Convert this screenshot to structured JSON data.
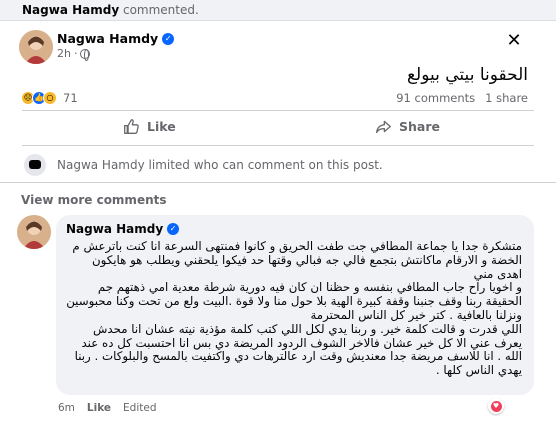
{
  "notification": {
    "actor": "Nagwa Hamdy",
    "action": "commented."
  },
  "post": {
    "author": "Nagwa Hamdy",
    "time": "2h",
    "privacy_icon": "globe-icon",
    "text": "الحقونا بيتي بيولع",
    "reaction_count": "71",
    "reaction_icons": [
      "sad-reaction-icon",
      "like-reaction-icon",
      "wow-reaction-icon"
    ],
    "comments": "91 comments",
    "shares": "1 share"
  },
  "actions": {
    "like": "Like",
    "share": "Share"
  },
  "limited_notice": "Nagwa Hamdy limited who can comment on this post.",
  "view_more": "View more comments",
  "comment": {
    "author": "Nagwa Hamdy",
    "paragraphs": [
      "متشكرة جدا يا جماعة المطافي جت طفت الحريق و كانوا فمنتهى السرعة انا كنت باترعش م الخضة و الارقام ماكانتش بتجمع فالي جه فبالي وقتها حد فيكوا يلحقني ويطلب هو هايكون اهدى مني",
      "و اخويا راح جاب المطافي بنفسه و حظنا ان كان فيه دورية شرطة معدية امي ذهتهم جم الحقيقة ربنا وقف جنبنا وقفة كبيرة الهية بلا حول منا ولا قوة .البيت ولع من تحت وكنا محبوسين ونزلنا بالعافية . كتر خير كل الناس المحترمة",
      "اللي قدرت و قالت كلمة خير. و ربنا يدي لكل اللي كتب كلمة مؤذية نيته عشان انا محدش يعرف عني الا كل خير عشان فالاخر الشوف الردود المريضة دي بس انا احتسبت كل ده عند الله . انا للاسف مريضة جدا معنديش وقت ارد عالترهات دي واكتفيت بالمسح والبلوكات . ربنا يهدي الناس كلها ."
    ],
    "time": "6m",
    "like_label": "Like",
    "edited_label": "Edited",
    "reaction_icon": "love-reaction-icon"
  },
  "colors": {
    "brand_blue": "#0866ff",
    "secondary_text": "#65676b",
    "background": "#f0f2f5"
  }
}
